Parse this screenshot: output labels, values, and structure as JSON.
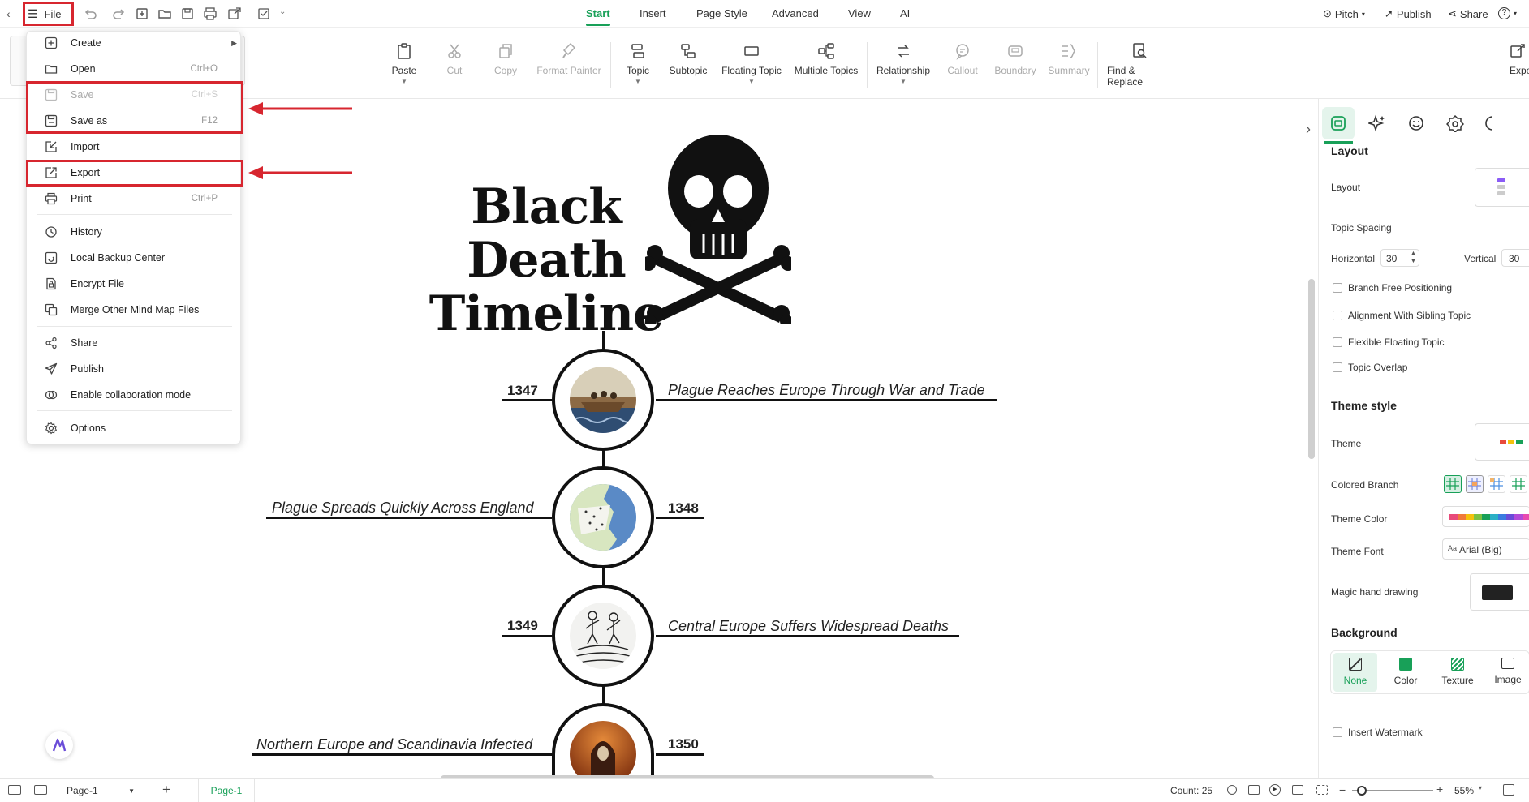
{
  "topbar": {
    "file_label": "File",
    "tabs": [
      "Start",
      "Insert",
      "Page Style",
      "Advanced",
      "View",
      "AI"
    ],
    "pitch_label": "Pitch",
    "publish_label": "Publish",
    "share_label": "Share"
  },
  "ribbon": {
    "paste": "Paste",
    "cut": "Cut",
    "copy": "Copy",
    "format_painter": "Format Painter",
    "topic": "Topic",
    "subtopic": "Subtopic",
    "floating_topic": "Floating Topic",
    "multiple_topics": "Multiple Topics",
    "relationship": "Relationship",
    "callout": "Callout",
    "boundary": "Boundary",
    "summary": "Summary",
    "find_replace": "Find & Replace",
    "export_partial": "Expo"
  },
  "file_menu": {
    "items": [
      {
        "label": "Create",
        "shortcut": "",
        "icon": "plus-square-icon"
      },
      {
        "label": "Open",
        "shortcut": "Ctrl+O",
        "icon": "folder-icon"
      },
      {
        "label": "Save",
        "shortcut": "Ctrl+S",
        "icon": "save-icon"
      },
      {
        "label": "Save as",
        "shortcut": "F12",
        "icon": "save-as-icon"
      },
      {
        "label": "Import",
        "shortcut": "",
        "icon": "import-icon"
      },
      {
        "label": "Export",
        "shortcut": "",
        "icon": "export-icon"
      },
      {
        "label": "Print",
        "shortcut": "Ctrl+P",
        "icon": "printer-icon"
      },
      {
        "label": "History",
        "shortcut": "",
        "icon": "clock-icon"
      },
      {
        "label": "Local Backup Center",
        "shortcut": "",
        "icon": "backup-icon"
      },
      {
        "label": "Encrypt File",
        "shortcut": "",
        "icon": "lock-file-icon"
      },
      {
        "label": "Merge Other Mind Map Files",
        "shortcut": "",
        "icon": "merge-icon"
      },
      {
        "label": "Share",
        "shortcut": "",
        "icon": "share-icon"
      },
      {
        "label": "Publish",
        "shortcut": "",
        "icon": "publish-icon"
      },
      {
        "label": "Enable collaboration mode",
        "shortcut": "",
        "icon": "collaboration-icon"
      },
      {
        "label": "Options",
        "shortcut": "",
        "icon": "gear-icon"
      }
    ]
  },
  "canvas": {
    "title_line1": "Black Death",
    "title_line2": "Timeline",
    "events": [
      {
        "year": "1347",
        "text": "Plague Reaches Europe Through War and Trade"
      },
      {
        "year": "1348",
        "text": "Plague Spreads Quickly Across England"
      },
      {
        "year": "1349",
        "text": "Central Europe Suffers Widespread Deaths"
      },
      {
        "year": "1350",
        "text": "Northern Europe and Scandinavia Infected"
      }
    ]
  },
  "right_panel": {
    "layout_heading": "Layout",
    "layout_label": "Layout",
    "topic_spacing": "Topic Spacing",
    "horizontal_label": "Horizontal",
    "horizontal_value": "30",
    "vertical_label": "Vertical",
    "vertical_value": "30",
    "checkboxes": [
      "Branch Free Positioning",
      "Alignment With Sibling Topic",
      "Flexible Floating Topic",
      "Topic Overlap"
    ],
    "theme_style_heading": "Theme style",
    "theme_label": "Theme",
    "colored_branch": "Colored Branch",
    "theme_color": "Theme Color",
    "theme_font": "Theme Font",
    "theme_font_value": "Arial (Big)",
    "magic_hand": "Magic hand drawing",
    "background_heading": "Background",
    "bg_options": [
      "None",
      "Color",
      "Texture",
      "Image"
    ],
    "insert_watermark": "Insert Watermark"
  },
  "statusbar": {
    "page_select": "Page-1",
    "page_tab": "Page-1",
    "count": "Count: 25",
    "zoom": "55%"
  },
  "colors": {
    "accent": "#18a058",
    "highlight": "#d7262f"
  }
}
